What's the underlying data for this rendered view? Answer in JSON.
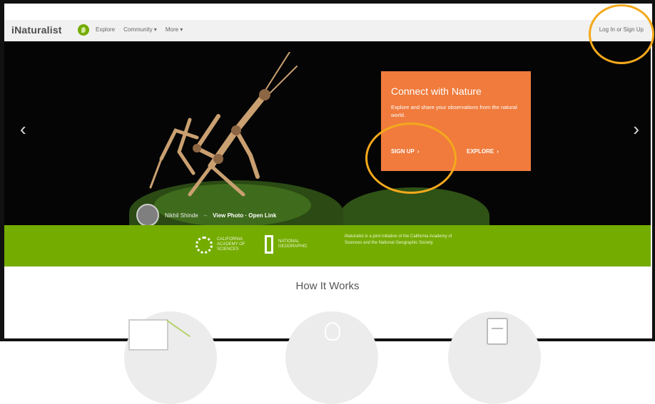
{
  "nav": {
    "brand": "iNaturalist",
    "links": [
      "Explore",
      "Community ▾",
      "More ▾"
    ],
    "login": "Log In or Sign Up"
  },
  "hero": {
    "prev_arrow": "‹",
    "next_arrow": "›",
    "cta": {
      "title": "Connect with Nature",
      "text": "Explore and share your observations from the natural world.",
      "signup": "SIGN UP",
      "explore": "EXPLORE"
    },
    "credit": {
      "name": "Nikhil Shinde",
      "separator": "–",
      "link": "View Photo · Open Link"
    }
  },
  "band": {
    "partner1": "CALIFORNIA ACADEMY OF SCIENCES",
    "partner2": "NATIONAL GEOGRAPHIC",
    "text": "iNaturalist is a joint initiative of the California Academy of Sciences and the National Geographic Society"
  },
  "how": {
    "title": "How It Works"
  },
  "colors": {
    "accent_green": "#74ac00",
    "cta_orange": "#f07b3c",
    "annotation": "#f4a91c"
  }
}
